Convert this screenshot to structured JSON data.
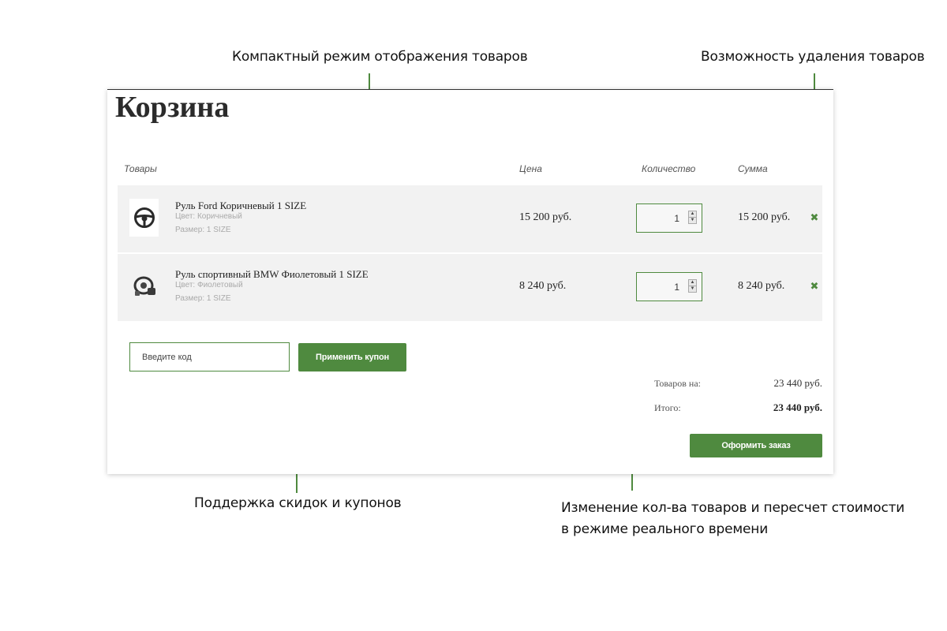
{
  "annotations": {
    "compact_mode": "Компактный режим отображения товаров",
    "removal": "Возможность удаления товаров",
    "coupons": "Поддержка скидок и купонов",
    "realtime_line1": "Изменение кол-ва товаров и пересчет стоимости",
    "realtime_line2": "в режиме реального времени"
  },
  "cart": {
    "title": "Корзина",
    "columns": {
      "products": "Товары",
      "price": "Цена",
      "quantity": "Количество",
      "sum": "Сумма"
    },
    "items": [
      {
        "name": "Руль Ford Коричневый 1 SIZE",
        "color": "Цвет: Коричневый",
        "size": "Размер: 1 SIZE",
        "price": "15 200 руб.",
        "quantity": "1",
        "sum": "15 200 руб.",
        "thumb_icon": "steering-wheel-icon"
      },
      {
        "name": "Руль спортивный BMW Фиолетовый 1 SIZE",
        "color": "Цвет: Фиолетовый",
        "size": "Размер: 1 SIZE",
        "price": "8 240 руб.",
        "quantity": "1",
        "sum": "8 240 руб.",
        "thumb_icon": "racing-wheel-icon"
      }
    ],
    "coupon": {
      "placeholder": "Введите код",
      "apply_label": "Применить купон"
    },
    "totals": {
      "goods_label": "Товаров на:",
      "goods_value": "23 440 руб.",
      "total_label": "Итого:",
      "total_value": "23 440 руб."
    },
    "checkout_label": "Оформить заказ"
  },
  "colors": {
    "accent": "#4f8a3f",
    "row_bg": "#f2f2f2"
  }
}
